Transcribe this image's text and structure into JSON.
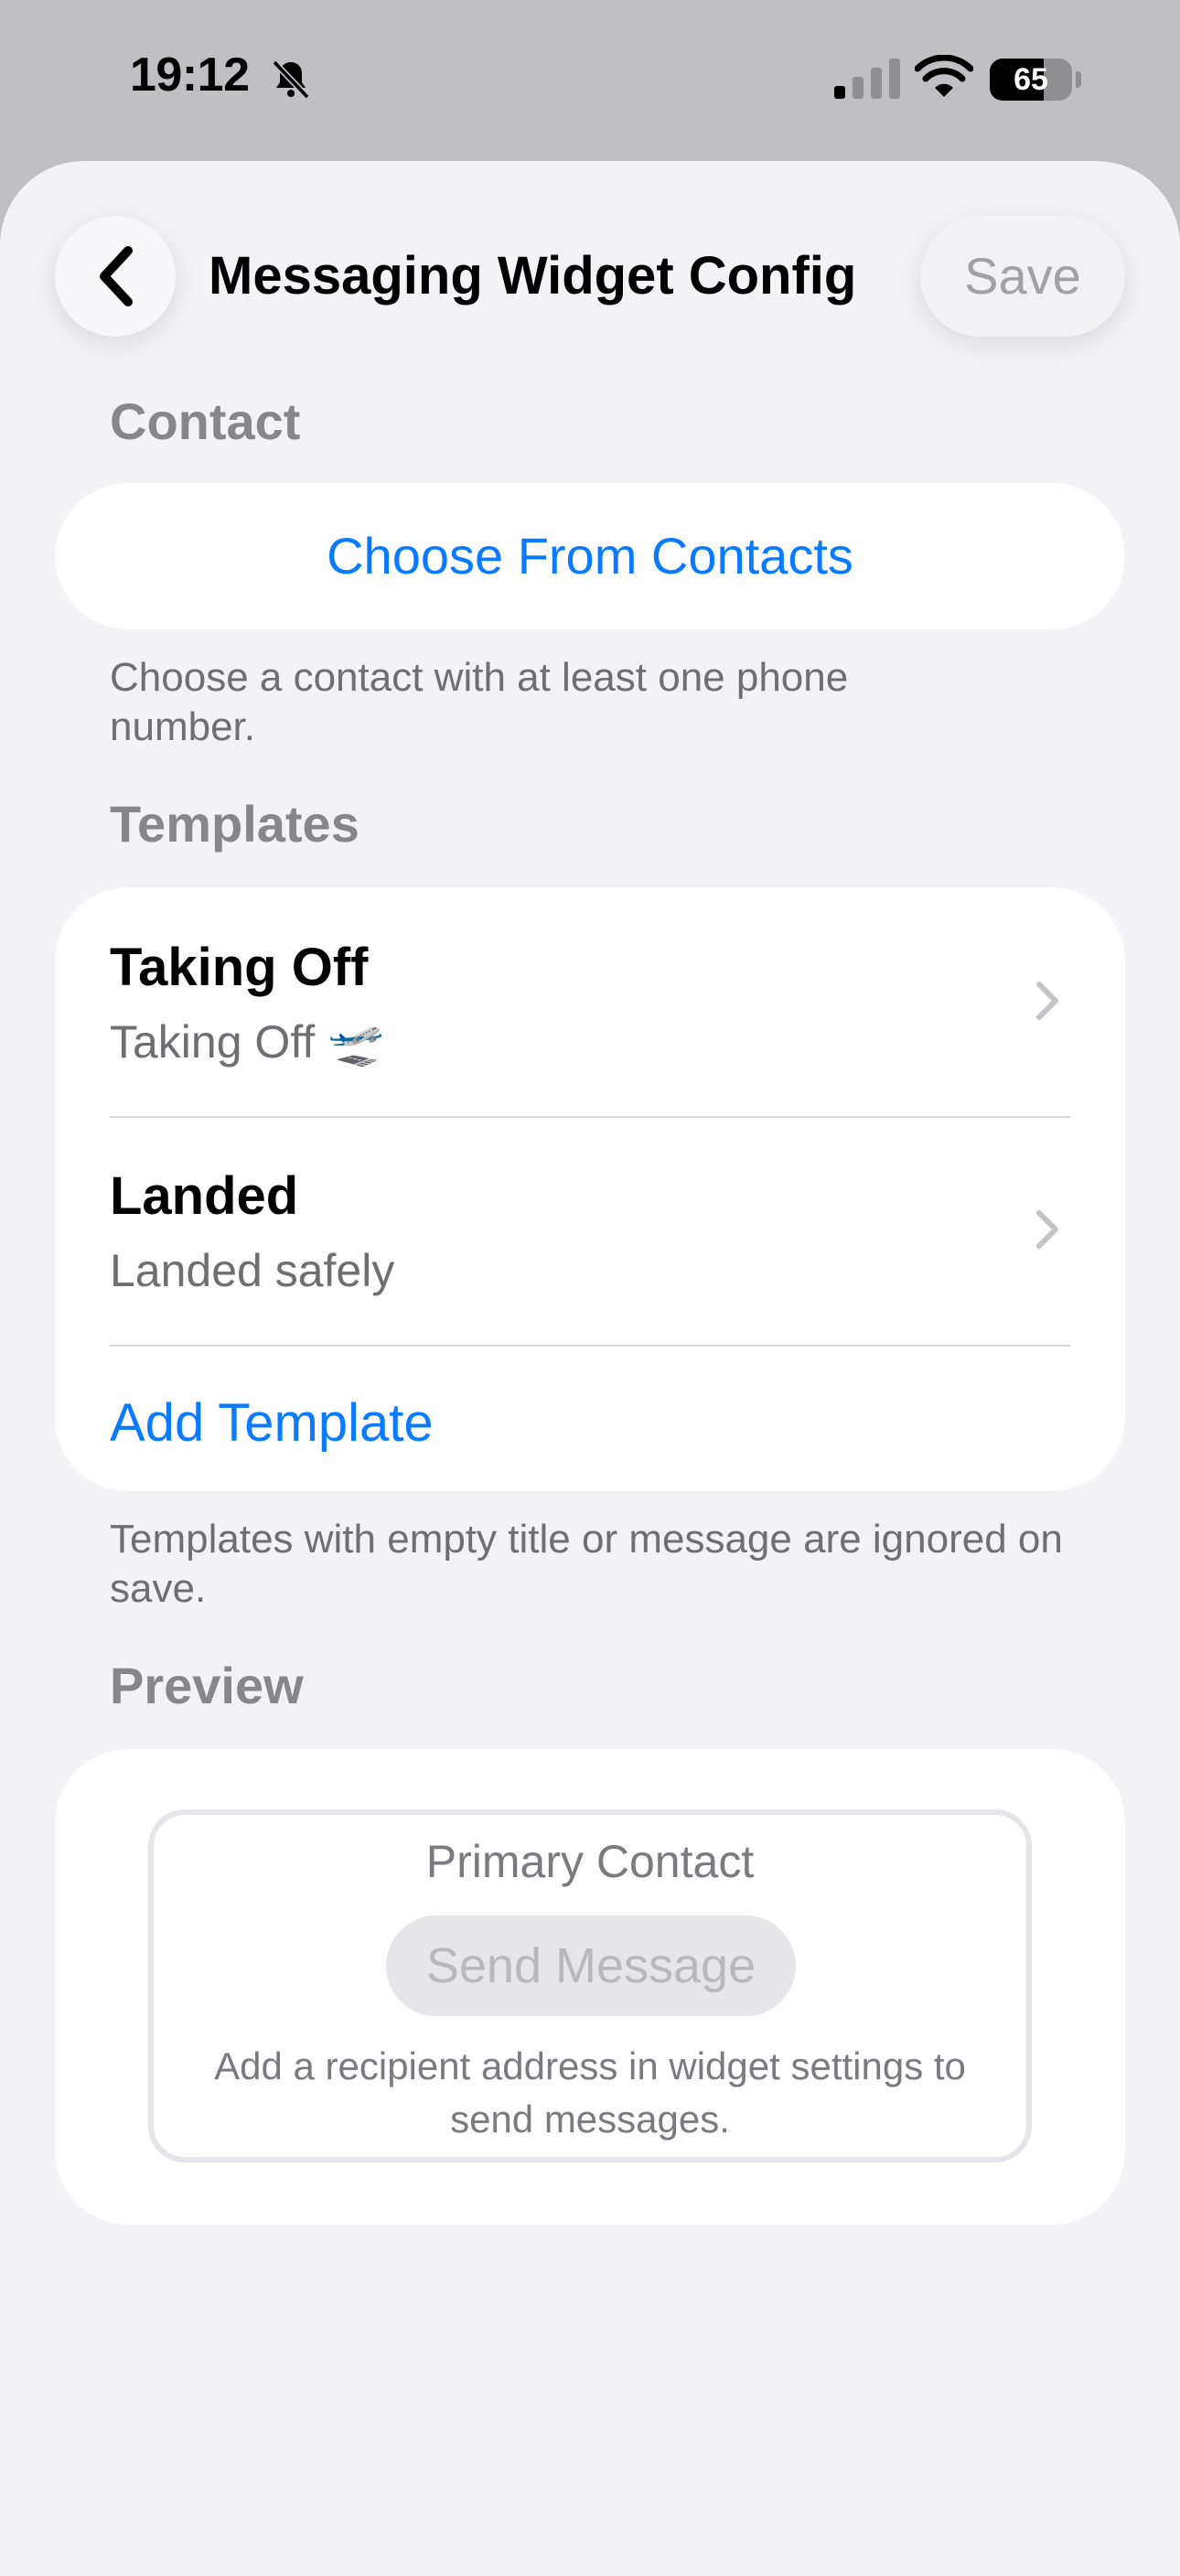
{
  "status_bar": {
    "time": "19:12",
    "battery_level": 65,
    "battery_text": "65",
    "icons": [
      "bell-slash-icon",
      "cellular-signal-icon",
      "wifi-icon",
      "battery-icon"
    ]
  },
  "nav": {
    "back_icon": "chevron-left-icon",
    "title": "Messaging Widget Config",
    "save_label": "Save"
  },
  "contact": {
    "header": "Contact",
    "choose_label": "Choose From Contacts",
    "footer": "Choose a contact with at least one phone number."
  },
  "templates": {
    "header": "Templates",
    "items": [
      {
        "title": "Taking Off",
        "message": "Taking Off 🛫"
      },
      {
        "title": "Landed",
        "message": "Landed safely"
      }
    ],
    "add_label": "Add Template",
    "footer": "Templates with empty title or message are ignored on save."
  },
  "preview": {
    "header": "Preview",
    "contact_label": "Primary Contact",
    "send_label": "Send Message",
    "note": "Add a recipient address in widget settings to send messages."
  },
  "colors": {
    "accent": "#0a7aff",
    "background": "#f2f2f7",
    "secondary_text": "#86868b"
  }
}
